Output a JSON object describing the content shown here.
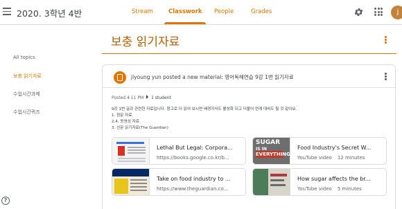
{
  "header": {
    "class_title": "2020. 3학년 4반",
    "tabs": [
      "Stream",
      "Classwork",
      "People",
      "Grades"
    ],
    "active_tab": "Classwork",
    "avatar_letter": "j",
    "accent_color": "#e37400"
  },
  "sidebar": {
    "items": [
      "All topics",
      "보충 읽기자료",
      "수업시간과제",
      "수업시간퀴즈"
    ],
    "active_item": "보충 읽기자료",
    "help_glyph": "?"
  },
  "topic": {
    "title": "보충 읽기자료"
  },
  "post": {
    "header": "jiyoung yun posted a new material: 영어독해연습 9강 1번 읽기자료",
    "time": "Posted 4:11 PM",
    "students": "1 student",
    "description": [
      "9강 1번 글과 관련한 자료입니다. 참고로 더 읽어 보시면 배경지식도 활성화 되고 더불어 연계 대비도 될 것 같아요.",
      "1. 원문 자료",
      "2,4. 동영상 자료",
      "3. 신문 읽기자료(The Guardian)"
    ],
    "attachments": [
      {
        "title": "Lethal But Legal: Corpora...",
        "subtitle": "https://books.google.co.kr/b...",
        "duration": ""
      },
      {
        "title": "Food Industry's Secret W...",
        "subtitle": "YouTube video",
        "duration": "12 minutes",
        "thumb_text": [
          "SUGAR",
          "IS IN",
          "EVERYTHING"
        ]
      },
      {
        "title": "Take on food industry to ...",
        "subtitle": "https://www.theguardian.co...",
        "duration": ""
      },
      {
        "title": "How sugar affects the br...",
        "subtitle": "YouTube video",
        "duration": "5 minutes"
      }
    ]
  }
}
